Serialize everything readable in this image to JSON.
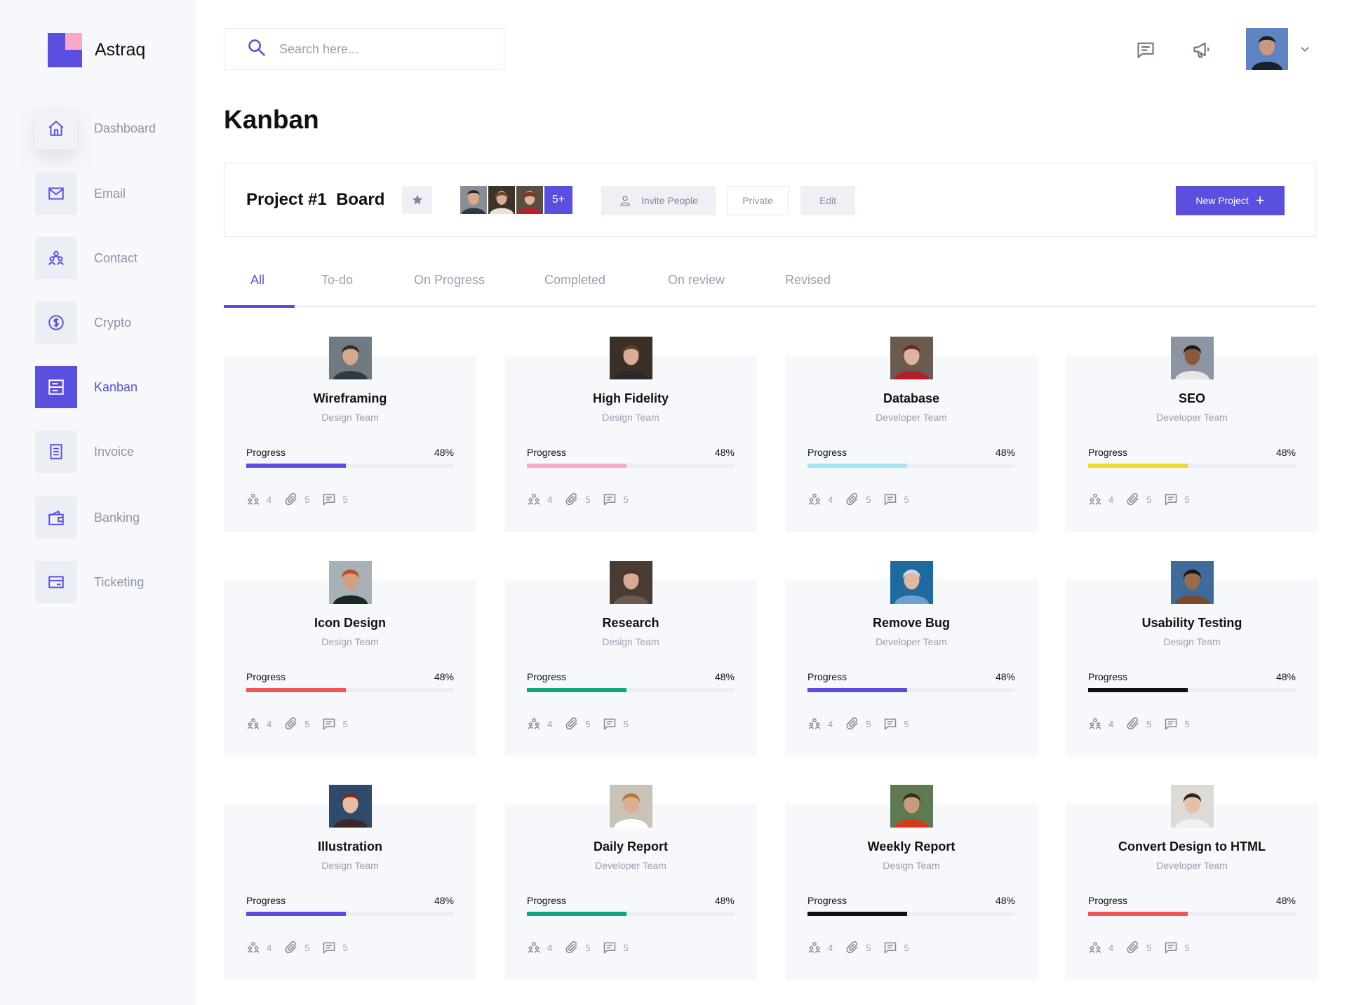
{
  "app": {
    "name": "Astraq"
  },
  "colors": {
    "accent": "#5b4fe0",
    "sidebar_bg": "#f7f8fc",
    "card_bg": "#f7f8fc",
    "muted_text": "#9aa0b3"
  },
  "sidebar": {
    "items": [
      {
        "label": "Dashboard",
        "icon": "home-icon"
      },
      {
        "label": "Email",
        "icon": "envelope-icon"
      },
      {
        "label": "Contact",
        "icon": "people-icon"
      },
      {
        "label": "Crypto",
        "icon": "dollar-coin-icon"
      },
      {
        "label": "Kanban",
        "icon": "kanban-icon",
        "active": true
      },
      {
        "label": "Invoice",
        "icon": "document-icon"
      },
      {
        "label": "Banking",
        "icon": "wallet-icon"
      },
      {
        "label": "Ticketing",
        "icon": "ticket-icon"
      }
    ]
  },
  "header": {
    "search_placeholder": "Search here...",
    "icons": [
      "chat-icon",
      "megaphone-icon",
      "chevron-down-icon"
    ]
  },
  "page": {
    "title": "Kanban"
  },
  "board": {
    "title": "Project #1  Board",
    "members_more": "5+",
    "invite_label": "Invite People",
    "private_label": "Private",
    "edit_label": "Edit",
    "new_project_label": "New Project"
  },
  "tabs": [
    {
      "label": "All",
      "active": true
    },
    {
      "label": "To-do"
    },
    {
      "label": "On Progress"
    },
    {
      "label": "Completed"
    },
    {
      "label": "On review"
    },
    {
      "label": "Revised"
    }
  ],
  "cards": [
    {
      "title": "Wireframing",
      "team": "Design Team",
      "progress_label": "Progress",
      "progress_text": "48%",
      "progress": 0.48,
      "color": "#5b4fe0",
      "members": "4",
      "attachments": "5",
      "comments": "5"
    },
    {
      "title": "High Fidelity",
      "team": "Design Team",
      "progress_label": "Progress",
      "progress_text": "48%",
      "progress": 0.48,
      "color": "#f7a9c6",
      "members": "4",
      "attachments": "5",
      "comments": "5"
    },
    {
      "title": "Database",
      "team": "Developer Team",
      "progress_label": "Progress",
      "progress_text": "48%",
      "progress": 0.48,
      "color": "#a9e4f2",
      "members": "4",
      "attachments": "5",
      "comments": "5"
    },
    {
      "title": "SEO",
      "team": "Developer Team",
      "progress_label": "Progress",
      "progress_text": "48%",
      "progress": 0.48,
      "color": "#f0db2a",
      "members": "4",
      "attachments": "5",
      "comments": "5"
    },
    {
      "title": "Icon Design",
      "team": "Design Team",
      "progress_label": "Progress",
      "progress_text": "48%",
      "progress": 0.48,
      "color": "#f2545b",
      "members": "4",
      "attachments": "5",
      "comments": "5"
    },
    {
      "title": "Research",
      "team": "Design Team",
      "progress_label": "Progress",
      "progress_text": "48%",
      "progress": 0.48,
      "color": "#12a57e",
      "members": "4",
      "attachments": "5",
      "comments": "5"
    },
    {
      "title": "Remove Bug",
      "team": "Developer Team",
      "progress_label": "Progress",
      "progress_text": "48%",
      "progress": 0.48,
      "color": "#5b4fe0",
      "members": "4",
      "attachments": "5",
      "comments": "5"
    },
    {
      "title": "Usability Testing",
      "team": "Design Team",
      "progress_label": "Progress",
      "progress_text": "48%",
      "progress": 0.48,
      "color": "#111111",
      "members": "4",
      "attachments": "5",
      "comments": "5"
    },
    {
      "title": "Illustration",
      "team": "Design Team",
      "progress_label": "Progress",
      "progress_text": "48%",
      "progress": 0.48,
      "color": "#5b4fe0",
      "members": "4",
      "attachments": "5",
      "comments": "5"
    },
    {
      "title": "Daily Report",
      "team": "Developer Team",
      "progress_label": "Progress",
      "progress_text": "48%",
      "progress": 0.48,
      "color": "#12a57e",
      "members": "4",
      "attachments": "5",
      "comments": "5"
    },
    {
      "title": "Weekly Report",
      "team": "Design Team",
      "progress_label": "Progress",
      "progress_text": "48%",
      "progress": 0.48,
      "color": "#111111",
      "members": "4",
      "attachments": "5",
      "comments": "5"
    },
    {
      "title": "Convert Design to HTML",
      "team": "Developer Team",
      "progress_label": "Progress",
      "progress_text": "48%",
      "progress": 0.48,
      "color": "#f2545b",
      "members": "4",
      "attachments": "5",
      "comments": "5"
    }
  ]
}
